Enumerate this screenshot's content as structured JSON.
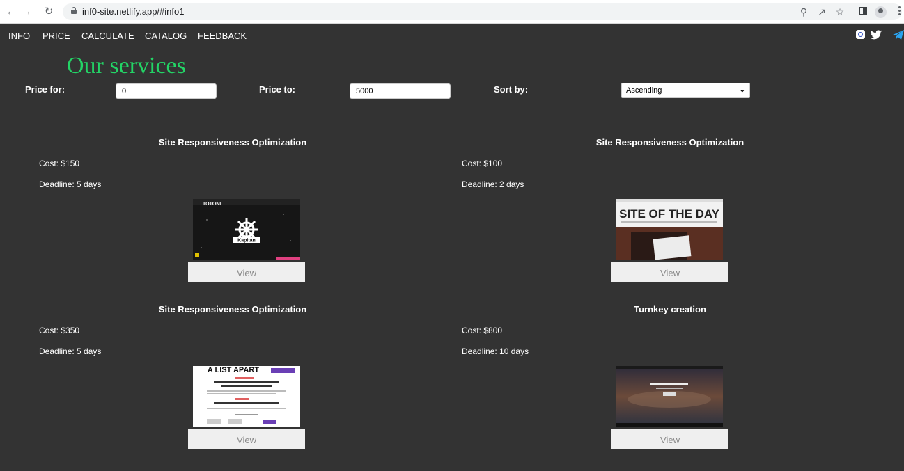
{
  "browser": {
    "url": "inf0-site.netlify.app/#info1",
    "back_icon": "arrow-left-icon",
    "forward_icon": "arrow-right-icon",
    "reload_icon": "reload-icon"
  },
  "nav": {
    "items": [
      {
        "label": "INFO"
      },
      {
        "label": "PRICE"
      },
      {
        "label": "CALCULATE"
      },
      {
        "label": "CATALOG"
      },
      {
        "label": "FEEDBACK"
      }
    ]
  },
  "social": [
    "instagram-icon",
    "twitter-icon",
    "telegram-icon"
  ],
  "page": {
    "title": "Our services",
    "title_color": "#23d466",
    "background": "#333333"
  },
  "filters": {
    "price_for_label": "Price for:",
    "price_for_value": "0",
    "price_to_label": "Price to:",
    "price_to_value": "5000",
    "sort_label": "Sort by:",
    "sort_value": "Ascending"
  },
  "cards": [
    {
      "title": "Site Responsiveness Optimization",
      "cost": "Cost: $150",
      "deadline": "Deadline: 5 days",
      "thumb_text": "TOTONI",
      "thumb_caption": "Kapitan",
      "button": "View"
    },
    {
      "title": "Site Responsiveness Optimization",
      "cost": "Cost: $100",
      "deadline": "Deadline: 2 days",
      "thumb_text": "SITE OF THE DAY",
      "button": "View"
    },
    {
      "title": "Site Responsiveness Optimization",
      "cost": "Cost: $350",
      "deadline": "Deadline: 5 days",
      "thumb_text": "A LIST APART",
      "button": "View"
    },
    {
      "title": "Turnkey creation",
      "cost": "Cost: $800",
      "deadline": "Deadline: 10 days",
      "button": "View"
    }
  ]
}
